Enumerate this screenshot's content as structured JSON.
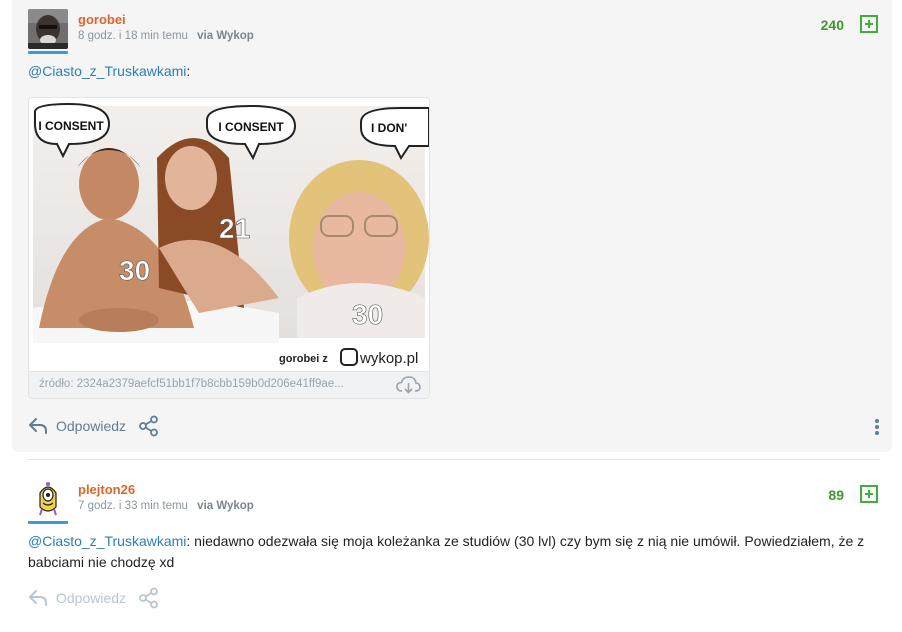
{
  "comments": [
    {
      "username": "gorobei",
      "time": "8 godz. i 18 min temu",
      "via": "via Wykop",
      "votes": "240",
      "mention": "@Ciasto_z_Truskawkami",
      "text_after": ":",
      "embed": {
        "bubbles": [
          "I CONSENT",
          "I CONSENT",
          "I DON'"
        ],
        "ages": [
          "30",
          "21",
          "30"
        ],
        "watermark_user": "gorobei z",
        "watermark_site": "wykop.pl",
        "source": "źródło: 2324a2379aefcf51bb1f7b8cbb159b0d206e41ff9ae..."
      },
      "reply_label": "Odpowiedz"
    },
    {
      "username": "plejton26",
      "time": "7 godz. i 33 min temu",
      "via": "via Wykop",
      "votes": "89",
      "mention": "@Ciasto_z_Truskawkami",
      "text_after": ": niedawno odezwała się moja koleżanka ze studiów (30 lvl) czy bym się z nią nie umówił. Powiedziałem, że z babciami nie chodzę xd",
      "reply_label": "Odpowiedz"
    }
  ],
  "colors": {
    "username": "#e0652a",
    "mention": "#2e7cb6",
    "vote": "#3c9a2c",
    "avatar_underline": "#3c9ad3"
  },
  "icons": [
    "reply-icon",
    "share-icon",
    "plus-icon",
    "download-cloud-icon",
    "more-vertical-icon"
  ]
}
